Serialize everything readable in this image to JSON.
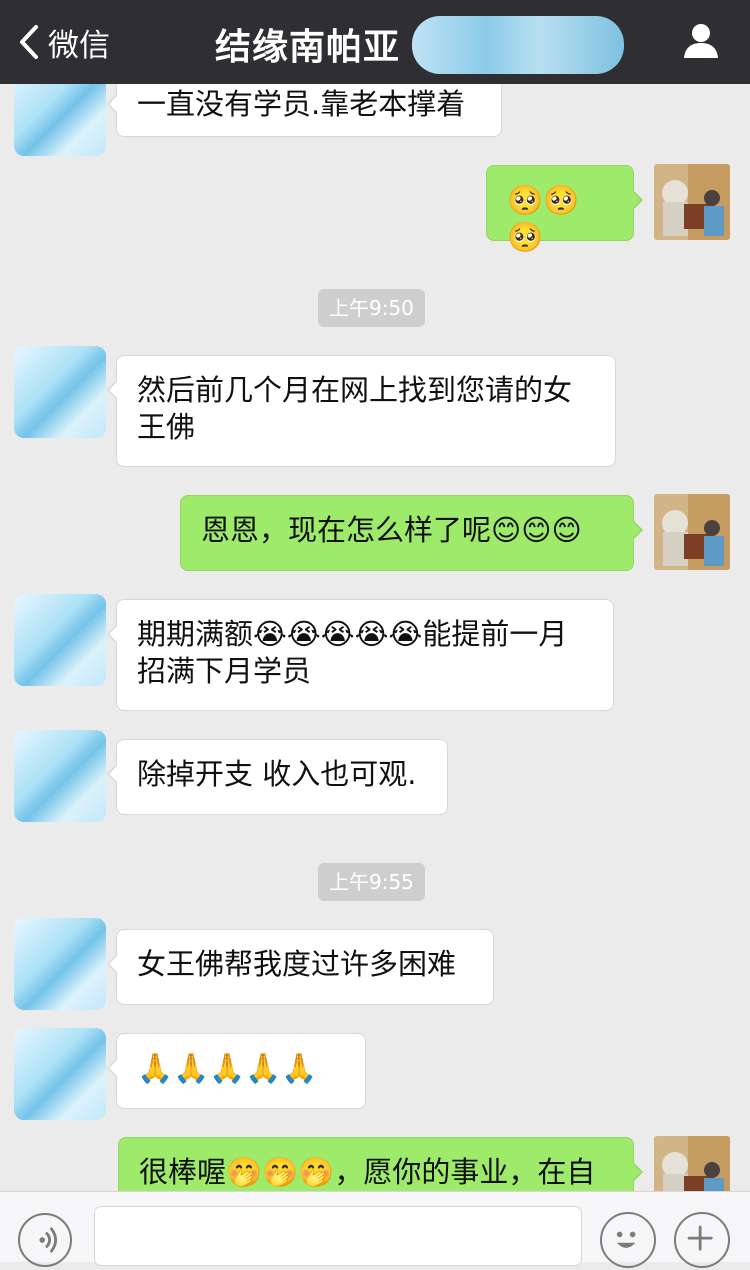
{
  "header": {
    "back_label": "微信",
    "title": "结缘南帕亚"
  },
  "timestamps": [
    "上午9:50",
    "上午9:55"
  ],
  "messages": [
    {
      "side": "left",
      "text": "一直没有学员.靠老本撑着"
    },
    {
      "side": "right",
      "text": "🥺🥺🥺"
    },
    {
      "side": "left",
      "text": "然后前几个月在网上找到您请的女王佛"
    },
    {
      "side": "right",
      "text": "恩恩，现在怎么样了呢😊😊😊"
    },
    {
      "side": "left",
      "text": "期期满额😭😭😭😭😭能提前一月招满下月学员"
    },
    {
      "side": "left",
      "text": "除掉开支 收入也可观."
    },
    {
      "side": "left",
      "text": "女王佛帮我度过许多困难"
    },
    {
      "side": "left",
      "text": "🙏🙏🙏🙏🙏"
    },
    {
      "side": "right",
      "text": "很棒喔🤭🤭🤭，愿你的事业，在自"
    }
  ],
  "icons": {
    "back": "chevron-left-icon",
    "profile": "person-icon",
    "voice": "voice-icon",
    "emoji": "emoji-icon",
    "plus": "plus-icon"
  }
}
